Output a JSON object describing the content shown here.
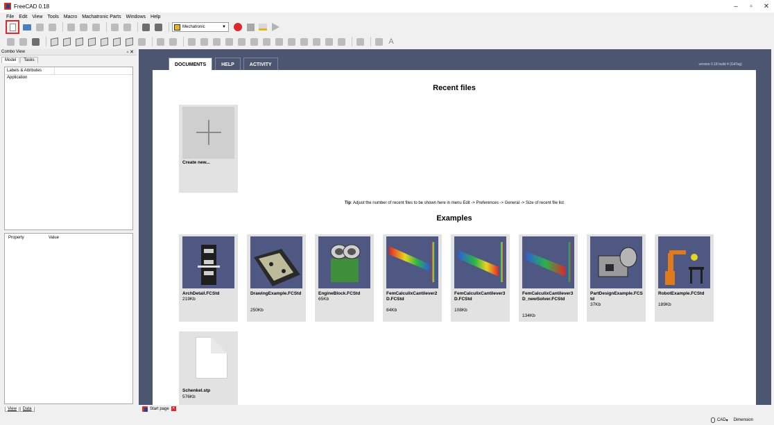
{
  "window": {
    "title": "FreeCAD 0.18",
    "controls": [
      "–",
      "▫",
      "✕"
    ]
  },
  "menu": [
    "File",
    "Edit",
    "View",
    "Tools",
    "Macro",
    "Machatronic Parts",
    "Windows",
    "Help"
  ],
  "toolbar": {
    "workbench": "Mechatronic"
  },
  "combo_view": {
    "title": "Combo View",
    "tabs": [
      "Model",
      "Tasks"
    ],
    "tree_header": "Labels & Attributes",
    "tree_items": [
      "Application"
    ],
    "property_columns": [
      "Property",
      "Value"
    ],
    "bottom_tabs": [
      "View",
      "Data"
    ]
  },
  "start_page": {
    "tabs": [
      "DOCUMENTS",
      "HELP",
      "ACTIVITY"
    ],
    "version": "version 0.18 build 4 (GitTag)",
    "recent_title": "Recent files",
    "create_new": "Create new...",
    "tip_label": "Tip",
    "tip_text": ": Adjust the number of recent files to be shown here in menu Edit -> Preferences -> General -> Size of recent file list",
    "examples_title": "Examples",
    "examples": [
      {
        "name": "ArchDetail.FCStd",
        "size": "219Kb",
        "icon": "arch-detail-thumbnail"
      },
      {
        "name": "DrawingExample.FCStd",
        "size": "250Kb",
        "icon": "drawing-example-thumbnail"
      },
      {
        "name": "EngineBlock.FCStd",
        "size": "65Kb",
        "icon": "engine-block-thumbnail"
      },
      {
        "name": "FemCalculixCantilever2D.FCStd",
        "size": "84Kb",
        "icon": "fem-2d-thumbnail"
      },
      {
        "name": "FemCalculixCantilever3D.FCStd",
        "size": "108Kb",
        "icon": "fem-3d-thumbnail"
      },
      {
        "name": "FemCalculixCantilever3D_newSolver.FCStd",
        "size": "134Kb",
        "icon": "fem-3d-new-thumbnail"
      },
      {
        "name": "PartDesignExample.FCStd",
        "size": "37Kb",
        "icon": "part-design-thumbnail"
      },
      {
        "name": "RobotExample.FCStd",
        "size": "189Kb",
        "icon": "robot-example-thumbnail"
      }
    ],
    "other_files": [
      {
        "name": "Schenkel.stp",
        "size": "576Kb",
        "icon": "file-icon"
      }
    ]
  },
  "doc_tab": {
    "label": "Start page"
  },
  "status": {
    "navigation": "CAD",
    "units": "Dimension"
  }
}
